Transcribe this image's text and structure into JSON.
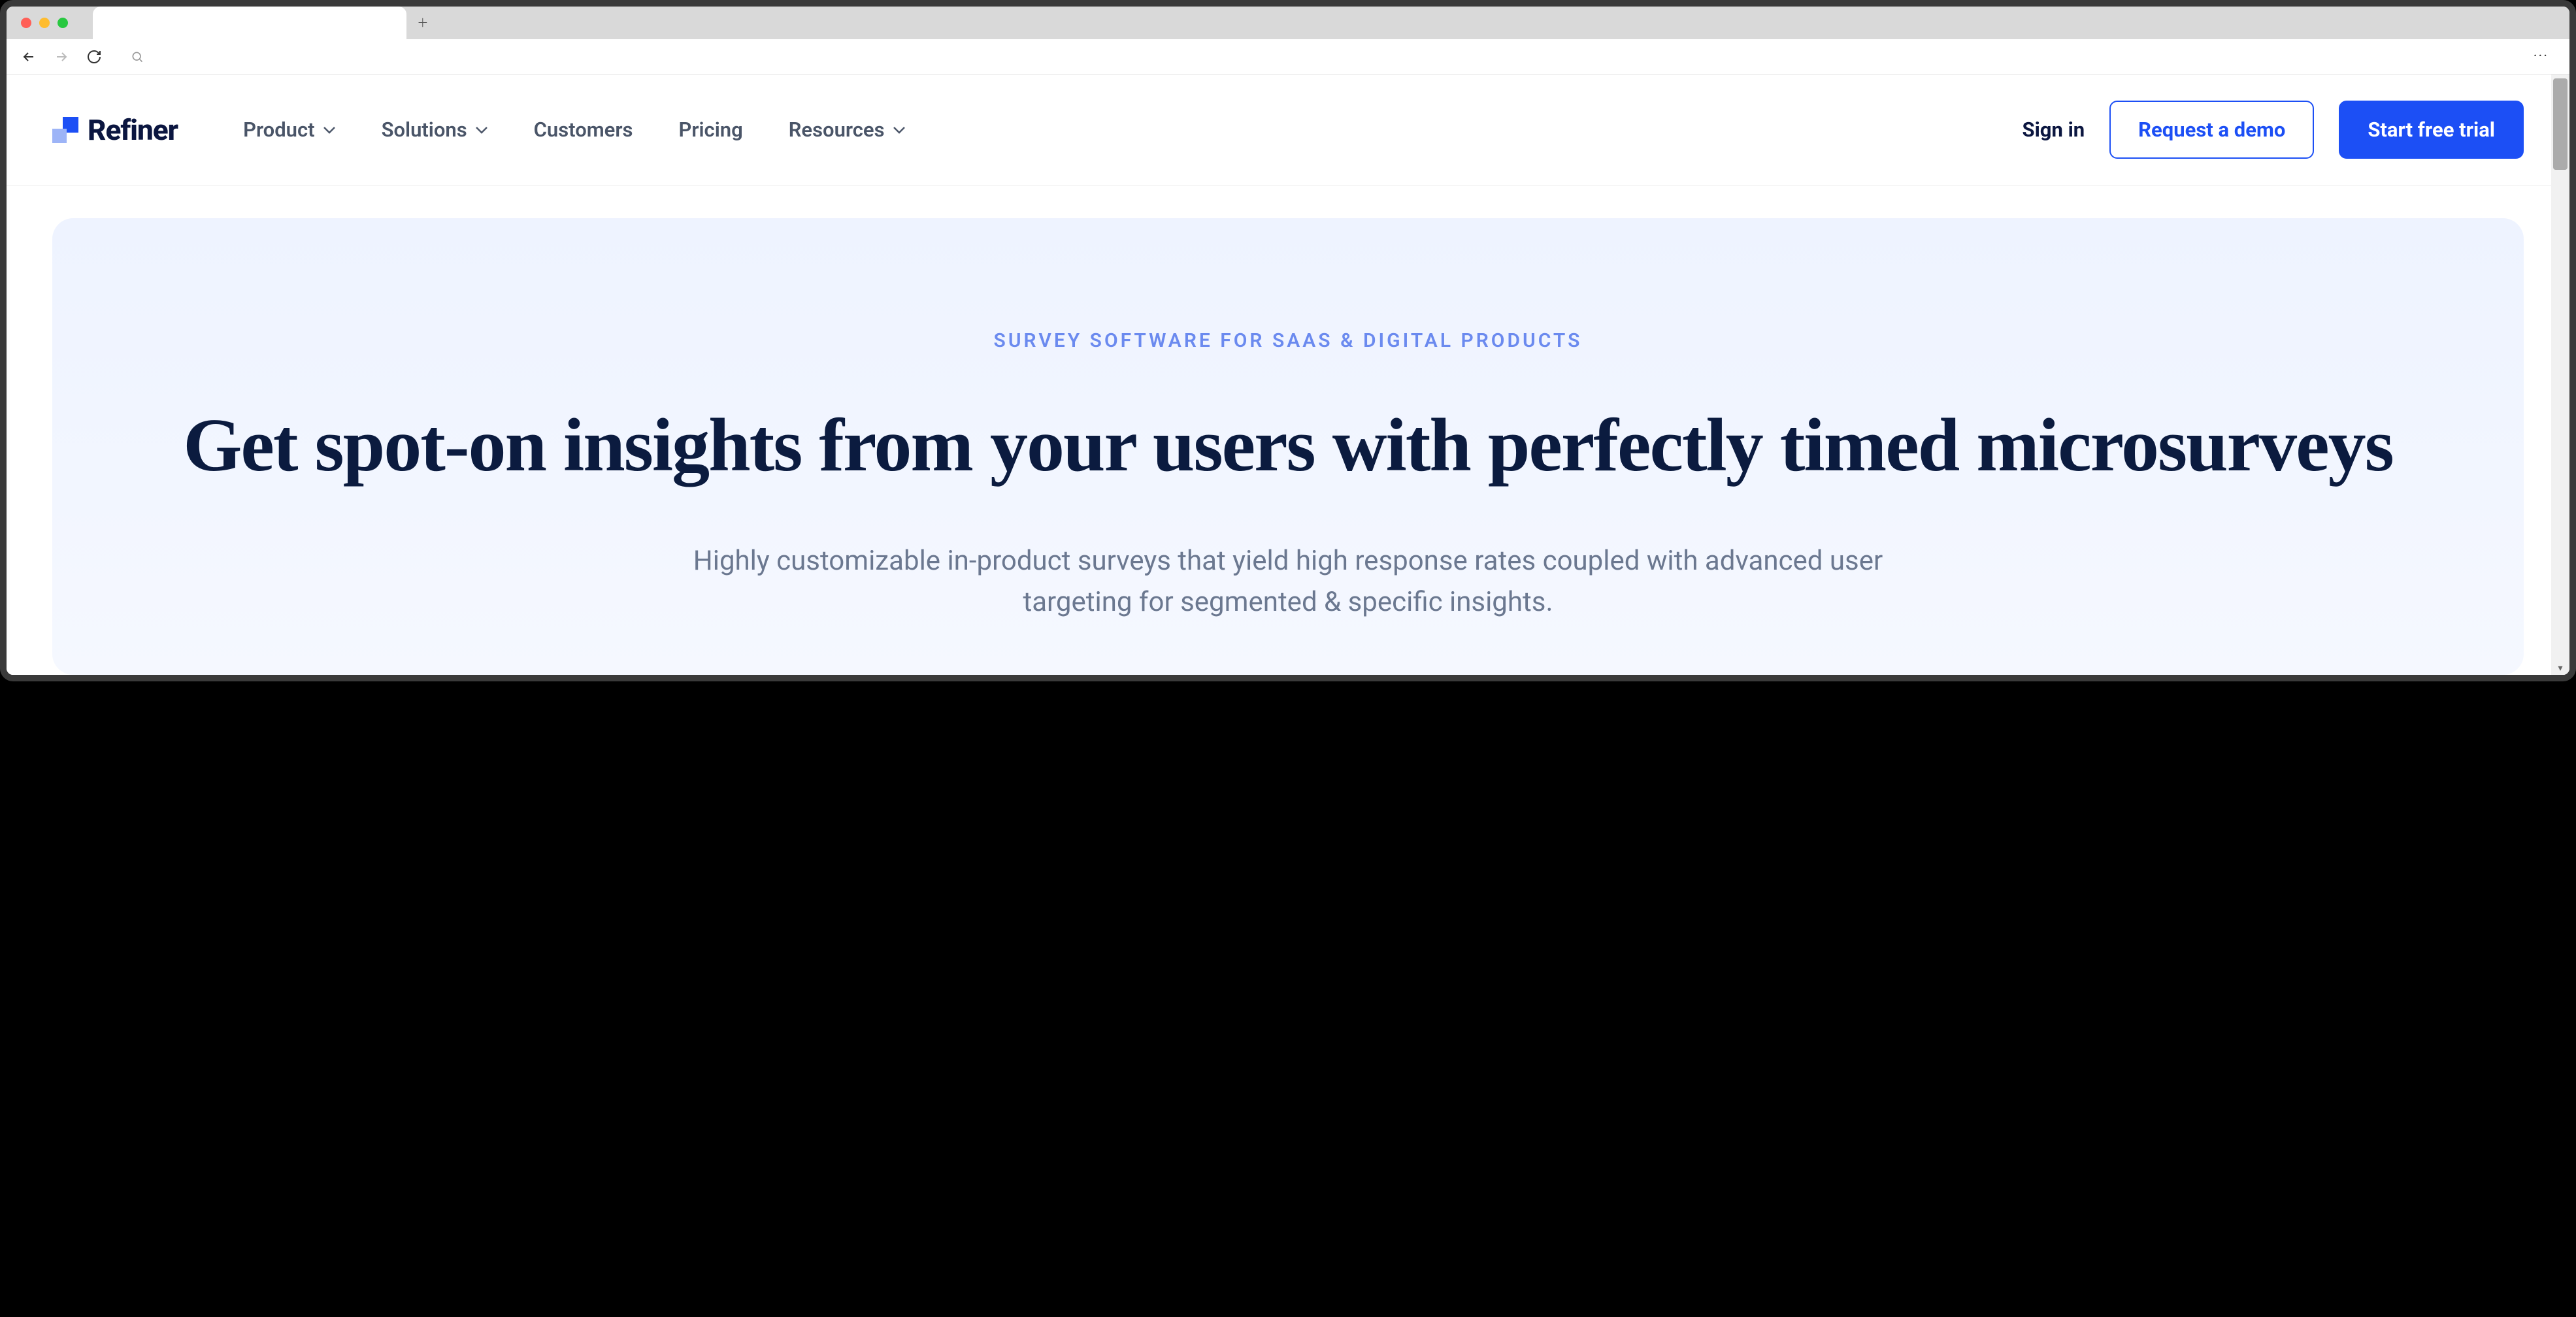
{
  "browser": {
    "new_tab_label": "+",
    "menu_dots": "···"
  },
  "brand": {
    "name": "Refiner"
  },
  "nav": {
    "items": [
      {
        "label": "Product",
        "has_dropdown": true
      },
      {
        "label": "Solutions",
        "has_dropdown": true
      },
      {
        "label": "Customers",
        "has_dropdown": false
      },
      {
        "label": "Pricing",
        "has_dropdown": false
      },
      {
        "label": "Resources",
        "has_dropdown": true
      }
    ],
    "signin": "Sign in",
    "request_demo": "Request a demo",
    "start_trial": "Start free trial"
  },
  "hero": {
    "eyebrow": "SURVEY SOFTWARE FOR SAAS & DIGITAL PRODUCTS",
    "title": "Get spot-on insights from your users with perfectly timed microsurveys",
    "subtitle": "Highly customizable in-product surveys that yield high response rates coupled with advanced user targeting for segmented & specific insights."
  }
}
